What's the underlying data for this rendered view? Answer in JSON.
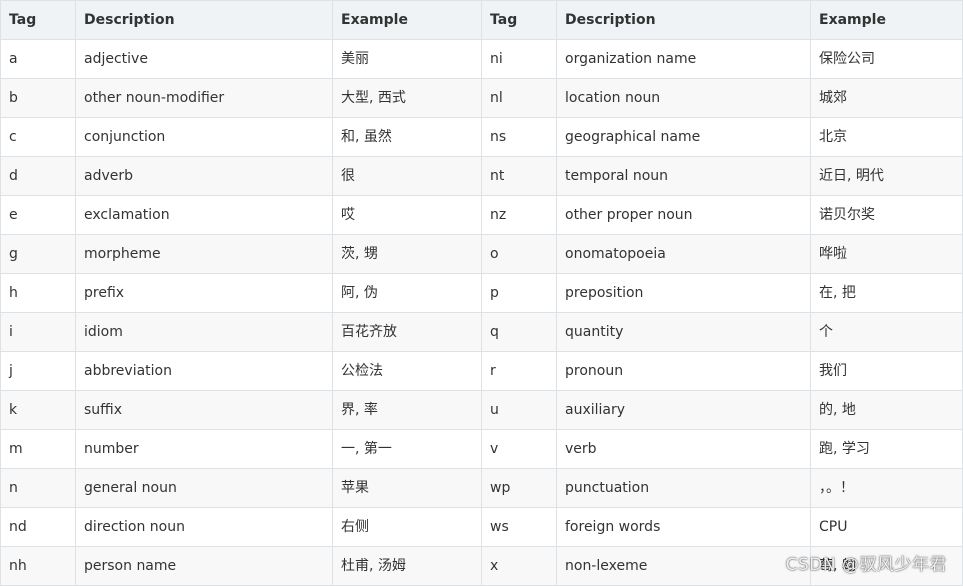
{
  "table": {
    "headers": [
      "Tag",
      "Description",
      "Example",
      "Tag",
      "Description",
      "Example"
    ],
    "rows": [
      [
        "a",
        "adjective",
        "美丽",
        "ni",
        "organization name",
        "保险公司"
      ],
      [
        "b",
        "other noun-modifier",
        "大型, 西式",
        "nl",
        "location noun",
        "城郊"
      ],
      [
        "c",
        "conjunction",
        "和, 虽然",
        "ns",
        "geographical name",
        "北京"
      ],
      [
        "d",
        "adverb",
        "很",
        "nt",
        "temporal noun",
        "近日, 明代"
      ],
      [
        "e",
        "exclamation",
        "哎",
        "nz",
        "other proper noun",
        "诺贝尔奖"
      ],
      [
        "g",
        "morpheme",
        "茨, 甥",
        "o",
        "onomatopoeia",
        "哗啦"
      ],
      [
        "h",
        "prefix",
        "阿, 伪",
        "p",
        "preposition",
        "在, 把"
      ],
      [
        "i",
        "idiom",
        "百花齐放",
        "q",
        "quantity",
        "个"
      ],
      [
        "j",
        "abbreviation",
        "公检法",
        "r",
        "pronoun",
        "我们"
      ],
      [
        "k",
        "suffix",
        "界, 率",
        "u",
        "auxiliary",
        "的, 地"
      ],
      [
        "m",
        "number",
        "一, 第一",
        "v",
        "verb",
        "跑, 学习"
      ],
      [
        "n",
        "general noun",
        "苹果",
        "wp",
        "punctuation",
        "，。！"
      ],
      [
        "nd",
        "direction noun",
        "右侧",
        "ws",
        "foreign words",
        "CPU"
      ],
      [
        "nh",
        "person name",
        "杜甫, 汤姆",
        "x",
        "non-lexeme",
        "萄, 翱"
      ]
    ]
  },
  "watermark": "CSDN @驭风少年君"
}
